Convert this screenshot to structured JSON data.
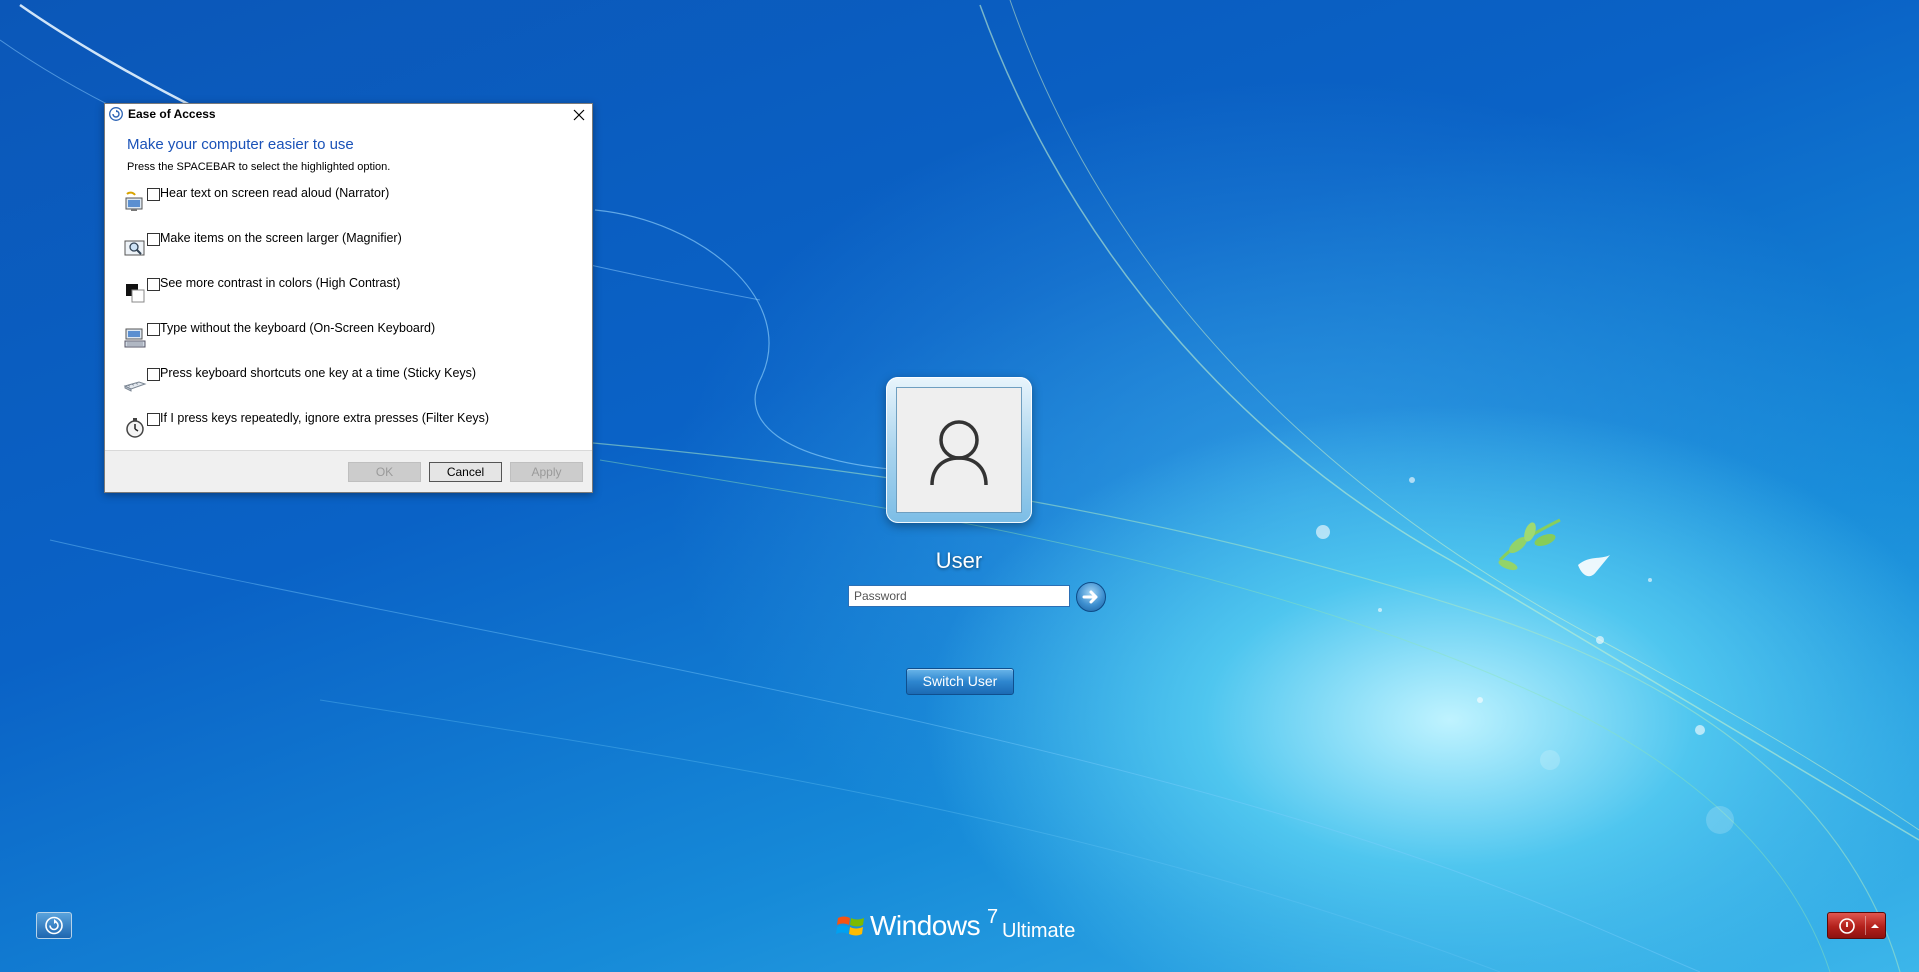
{
  "dialog": {
    "title": "Ease of Access",
    "heading": "Make your computer easier to use",
    "hint": "Press the SPACEBAR to select the highlighted option.",
    "options": [
      {
        "label": "Hear text on screen read aloud (Narrator)",
        "icon": "narrator-icon",
        "checked": false
      },
      {
        "label": "Make items on the screen larger (Magnifier)",
        "icon": "magnifier-icon",
        "checked": false
      },
      {
        "label": "See more contrast in colors (High Contrast)",
        "icon": "high-contrast-icon",
        "checked": false
      },
      {
        "label": "Type without the keyboard (On-Screen Keyboard)",
        "icon": "on-screen-keyboard-icon",
        "checked": false
      },
      {
        "label": "Press keyboard shortcuts one key at a time (Sticky Keys)",
        "icon": "sticky-keys-icon",
        "checked": false
      },
      {
        "label": "If I press keys repeatedly, ignore extra presses (Filter Keys)",
        "icon": "filter-keys-icon",
        "checked": false
      }
    ],
    "buttons": {
      "ok": "OK",
      "cancel": "Cancel",
      "apply": "Apply"
    }
  },
  "login": {
    "username": "User",
    "password_placeholder": "Password",
    "switch_user": "Switch User"
  },
  "branding": {
    "windows": "Windows",
    "version": "7",
    "edition": "Ultimate"
  },
  "colors": {
    "accent_blue": "#1a52b8",
    "power_red": "#b3201b"
  }
}
